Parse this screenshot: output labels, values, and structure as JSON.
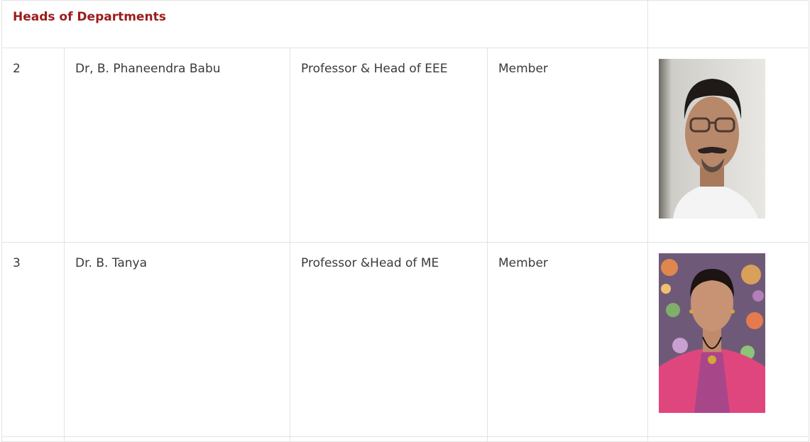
{
  "section": {
    "title": "Heads of Departments"
  },
  "rows": [
    {
      "sno": "2",
      "name": "Dr, B. Phaneendra Babu",
      "designation": "Professor & Head of EEE",
      "role": "Member",
      "photo": "portrait-man-icon"
    },
    {
      "sno": "3",
      "name": "Dr. B. Tanya",
      "designation": "Professor &Head of ME",
      "role": "Member",
      "photo": "portrait-woman-icon"
    }
  ],
  "colors": {
    "heading": "#9b1c1c",
    "border": "#e3e3e3",
    "text": "#3a3a3a"
  }
}
